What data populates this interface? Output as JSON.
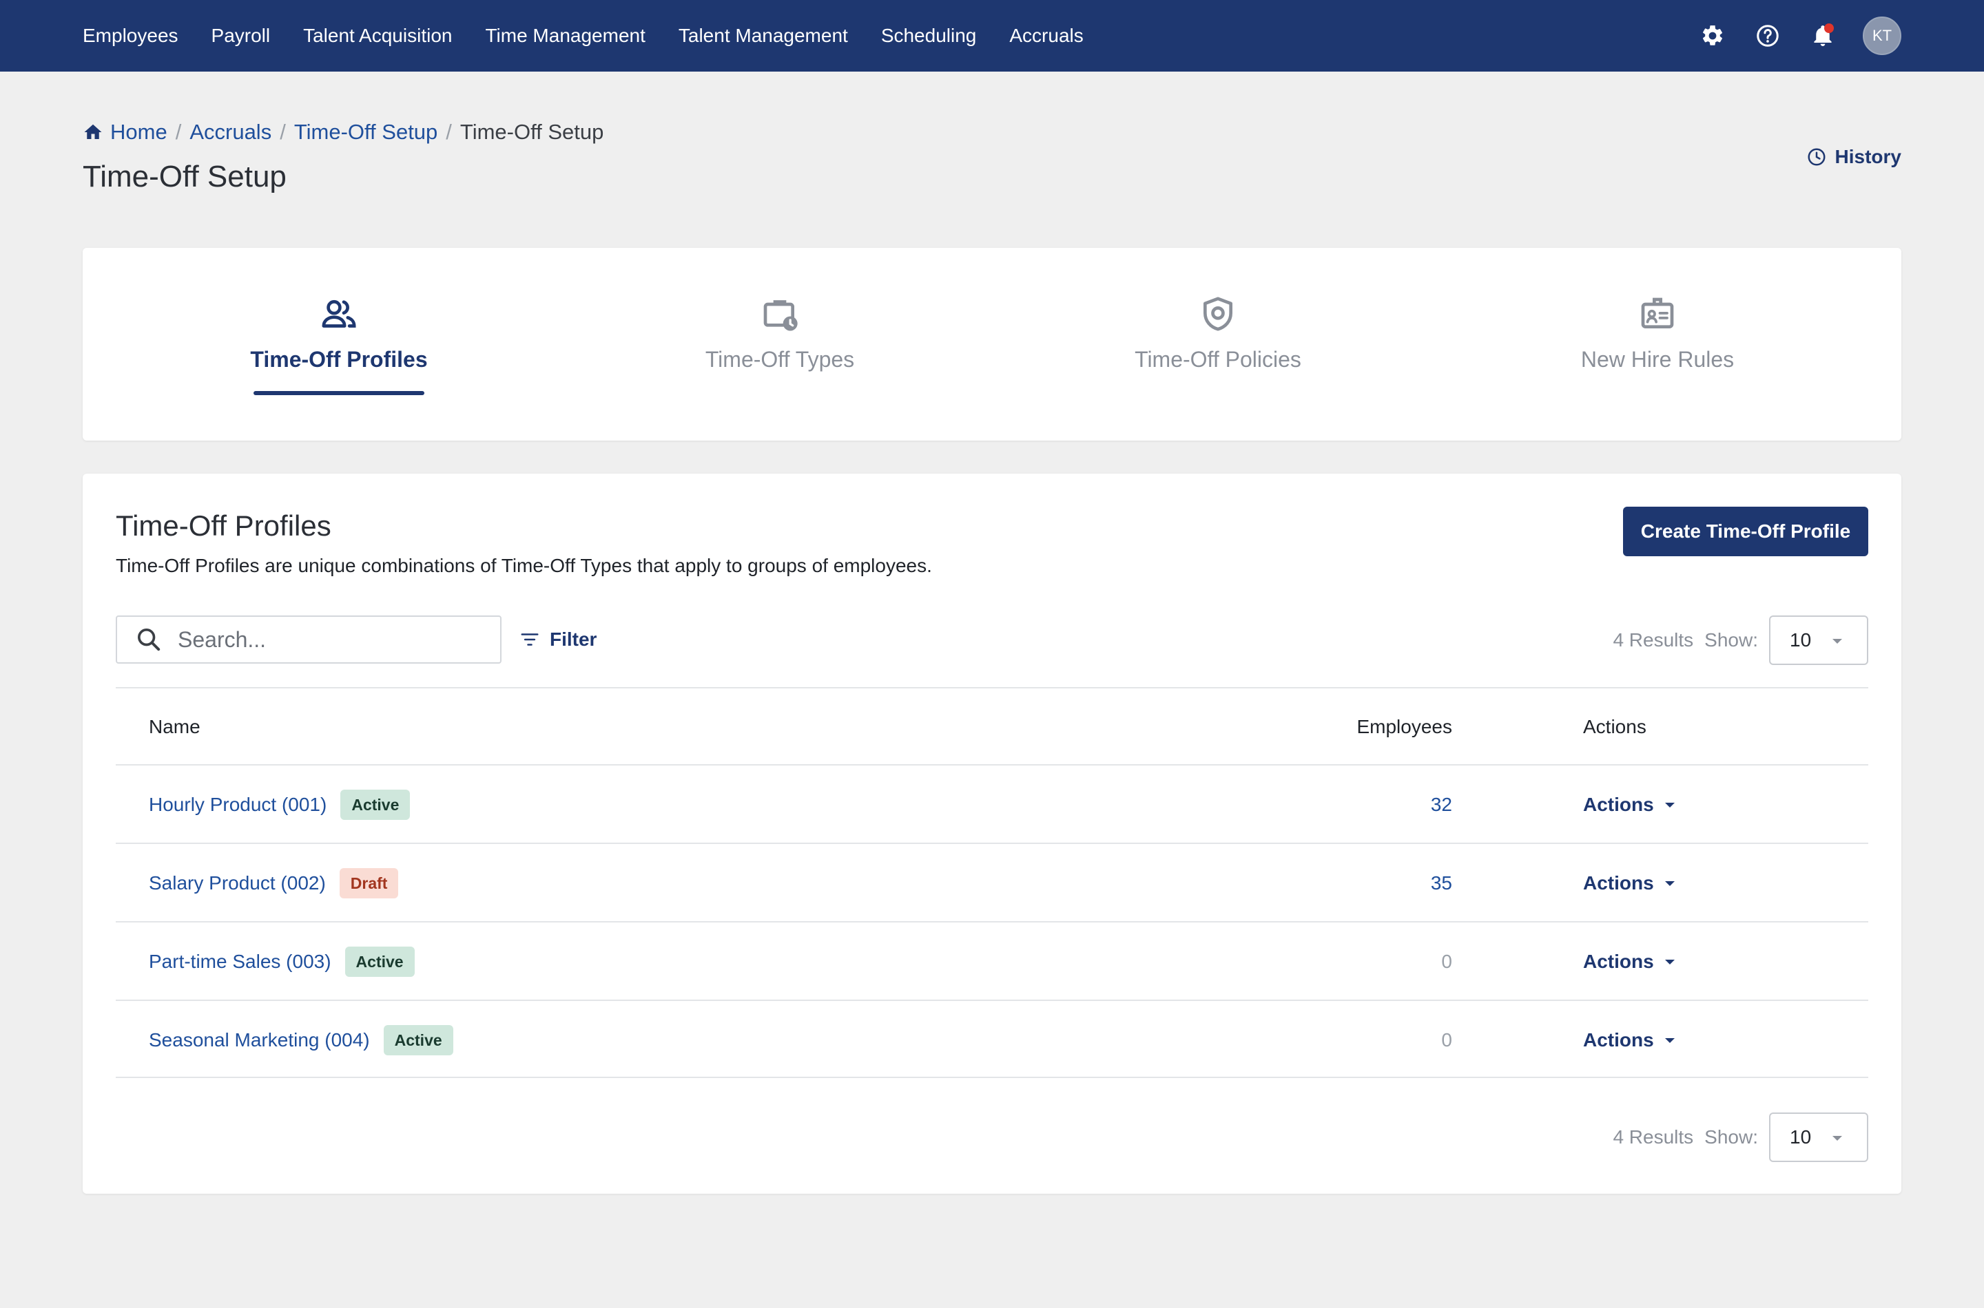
{
  "nav": {
    "items": [
      "Employees",
      "Payroll",
      "Talent Acquisition",
      "Time Management",
      "Talent Management",
      "Scheduling",
      "Accruals"
    ],
    "icons": [
      "gear-icon",
      "help-icon",
      "bell-icon"
    ],
    "avatar_initials": "KT"
  },
  "breadcrumb": {
    "home": "Home",
    "level1": "Accruals",
    "level2": "Time-Off Setup",
    "current": "Time-Off Setup",
    "separator": "/"
  },
  "page": {
    "title": "Time-Off Setup",
    "history_label": "History"
  },
  "tabs": [
    {
      "label": "Time-Off Profiles",
      "icon": "people-icon",
      "active": true
    },
    {
      "label": "Time-Off Types",
      "icon": "briefcase-clock-icon",
      "active": false
    },
    {
      "label": "Time-Off Policies",
      "icon": "shield-icon",
      "active": false
    },
    {
      "label": "New Hire Rules",
      "icon": "id-badge-icon",
      "active": false
    }
  ],
  "section": {
    "title": "Time-Off Profiles",
    "description": "Time-Off Profiles are unique combinations of Time-Off Types that apply to groups of employees.",
    "create_button": "Create Time-Off Profile"
  },
  "toolbar": {
    "search_placeholder": "Search...",
    "filter_label": "Filter",
    "results_text": "4 Results",
    "show_label": "Show:",
    "page_size": "10"
  },
  "table": {
    "columns": {
      "name": "Name",
      "employees": "Employees",
      "actions": "Actions"
    },
    "rows": [
      {
        "name": "Hourly Product (001)",
        "status": "Active",
        "employees": "32",
        "actions": "Actions"
      },
      {
        "name": "Salary Product (002)",
        "status": "Draft",
        "employees": "35",
        "actions": "Actions"
      },
      {
        "name": "Part-time Sales (003)",
        "status": "Active",
        "employees": "0",
        "actions": "Actions"
      },
      {
        "name": "Seasonal Marketing (004)",
        "status": "Active",
        "employees": "0",
        "actions": "Actions"
      }
    ]
  },
  "footer": {
    "results_text": "4 Results",
    "show_label": "Show:",
    "page_size": "10"
  },
  "colors": {
    "nav_bg": "#1e3770",
    "accent": "#1e3770",
    "link": "#1f4f9c",
    "active_badge_bg": "#cfe7dc",
    "draft_badge_bg": "#fadcd4",
    "page_bg": "#efefef"
  }
}
